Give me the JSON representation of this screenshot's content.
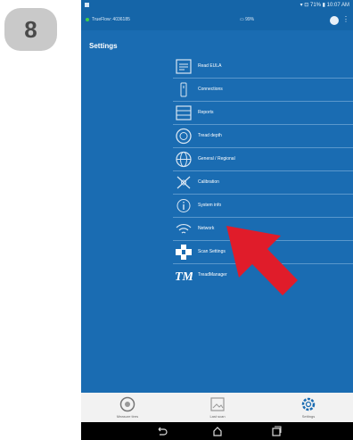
{
  "step_badge": {
    "number": "8"
  },
  "status_bar": {
    "time": "▾ ⊡ 71% ▮ 10:07 AM"
  },
  "header": {
    "truflow_label": "TrueFlow: 4036185",
    "center_label": "▭ 99%",
    "more_icon": "kebab-icon"
  },
  "settings": {
    "title": "Settings",
    "items": [
      {
        "label": "Read EULA",
        "icon": "eula-icon"
      },
      {
        "label": "Connections",
        "icon": "connections-icon"
      },
      {
        "label": "Reports",
        "icon": "reports-icon"
      },
      {
        "label": "Tread depth",
        "icon": "tread-depth-icon"
      },
      {
        "label": "General / Regional",
        "icon": "globe-icon"
      },
      {
        "label": "Calibration",
        "icon": "calibration-icon"
      },
      {
        "label": "System info",
        "icon": "system-info-icon"
      },
      {
        "label": "Network",
        "icon": "network-icon"
      },
      {
        "label": "Scan Settings",
        "icon": "scan-settings-icon"
      },
      {
        "label": "TreadManager",
        "icon": "tm-logo-icon"
      }
    ]
  },
  "tabs": [
    {
      "label": "Measure tires",
      "icon": "tire-icon"
    },
    {
      "label": "Last scan",
      "icon": "image-icon"
    },
    {
      "label": "Settings",
      "icon": "gear-icon"
    }
  ],
  "nav": [
    "back-icon",
    "home-icon",
    "recents-icon"
  ],
  "colors": {
    "panel": "#1a6cb2",
    "header": "#1565a8",
    "arrow": "#e01c2a"
  }
}
